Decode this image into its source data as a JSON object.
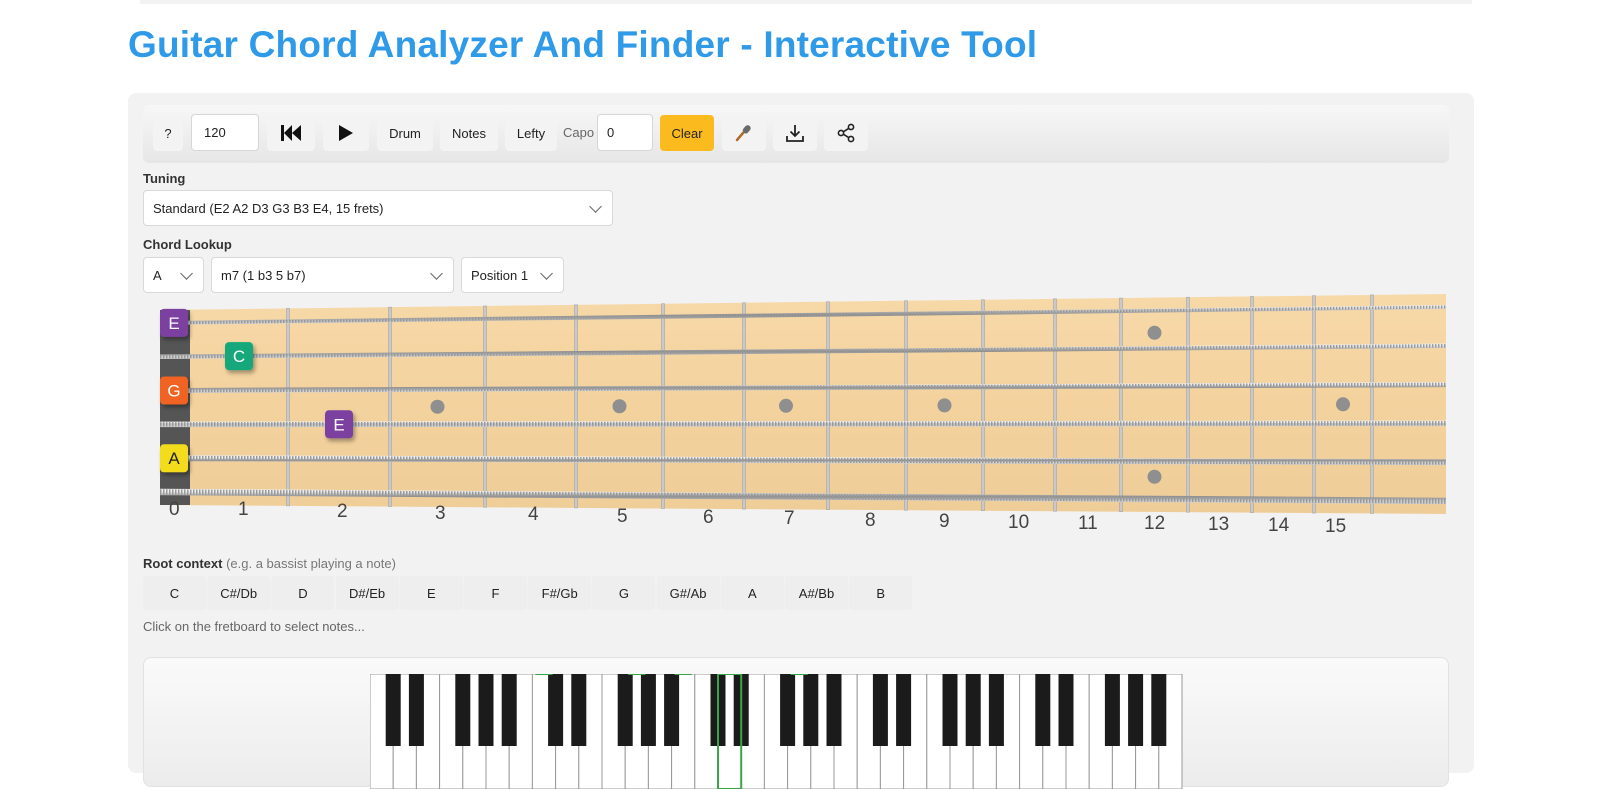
{
  "page": {
    "title": "Guitar Chord Analyzer And Finder - Interactive Tool"
  },
  "toolbar": {
    "help_label": "?",
    "tempo_value": "120",
    "rewind_icon": "skip-back-icon",
    "play_icon": "play-icon",
    "drum_label": "Drum",
    "notes_label": "Notes",
    "lefty_label": "Lefty",
    "capo_label": "Capo",
    "capo_value": "0",
    "clear_label": "Clear",
    "mic_icon": "microphone-icon",
    "download_icon": "download-icon",
    "share_icon": "share-icon"
  },
  "tuning": {
    "label": "Tuning",
    "value": "Standard (E2 A2 D3 G3 B3 E4, 15 frets)"
  },
  "chord_lookup": {
    "label": "Chord Lookup",
    "root": "A",
    "quality": "m7 (1 b3 5 b7)",
    "position": "Position 1"
  },
  "fretboard": {
    "fret_numbers": [
      "0",
      "1",
      "2",
      "3",
      "4",
      "5",
      "6",
      "7",
      "8",
      "9",
      "10",
      "11",
      "12",
      "13",
      "14",
      "15"
    ],
    "notes": [
      {
        "text": "E",
        "string": 0,
        "fret": 0,
        "color": "#7b3fa0"
      },
      {
        "text": "C",
        "string": 1,
        "fret": 1,
        "color": "#13a87a"
      },
      {
        "text": "G",
        "string": 2,
        "fret": 0,
        "color": "#f06424"
      },
      {
        "text": "E",
        "string": 3,
        "fret": 2,
        "color": "#7b3fa0"
      },
      {
        "text": "A",
        "string": 4,
        "fret": 0,
        "color": "#f3dc1a"
      }
    ]
  },
  "root_context": {
    "label": "Root context",
    "note": "(e.g. a bassist playing a note)",
    "notes": [
      "C",
      "C#/Db",
      "D",
      "D#/Eb",
      "E",
      "F",
      "F#/Gb",
      "G",
      "G#/Ab",
      "A",
      "A#/Bb",
      "B"
    ]
  },
  "hint": "Click on the fretboard to select notes..."
}
